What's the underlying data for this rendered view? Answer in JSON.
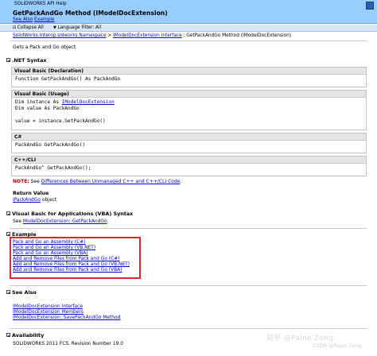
{
  "header": {
    "product": "SOLIDWORKS API Help",
    "title": "GetPackAndGo Method (IModelDocExtension)",
    "see_also": "See Also",
    "example": "Example"
  },
  "filterbar": {
    "collapse_all": "Collapse All",
    "language_filter": "Language Filter: All"
  },
  "breadcrumb": {
    "namespace": "SolidWorks.Interop.sldworks Namespace",
    "sep1": " > ",
    "interface": "IModelDocExtension Interface",
    "sep2": " : ",
    "current": "GetPackAndGo Method (IModelDocExtension)"
  },
  "summary": "Gets a Pack and Go object.",
  "syntax": {
    "heading": ".NET Syntax",
    "vb_decl_header": "Visual Basic (Declaration)",
    "vb_decl_code": "Function GetPackAndGo() As PackAndGo",
    "vb_usage_header": "Visual Basic (Usage)",
    "vb_usage_line1_prefix": "Dim instance As ",
    "vb_usage_line1_link": "IModelDocExtension",
    "vb_usage_line2": "Dim value As PackAndGo",
    "vb_usage_line3": "value = instance.GetPackAndGo()",
    "cs_header": "C#",
    "cs_code": "PackAndGo GetPackAndGo()",
    "cpp_header": "C++/CLI",
    "cpp_code": "PackAndGo^ GetPackAndGo();"
  },
  "note": {
    "label": "NOTE:",
    "text": " See ",
    "link": "Differences Between Unmanaged C++ and C++/CLI Code",
    "end": "."
  },
  "return_value": {
    "heading": "Return Value",
    "link": "IPackAndGo",
    "suffix": " object"
  },
  "vba": {
    "heading": "Visual Basic for Applications (VBA) Syntax",
    "see": "See ",
    "link": "ModelDocExtension::GetPackAndGo",
    "end": "."
  },
  "example": {
    "heading": "Example",
    "links": [
      "Pack and Go an Assembly (C#)",
      "Pack and Go an Assembly (VB.NET)",
      "Pack and Go an Assembly (VBA)",
      "Add and Remove Files from Pack and Go (C#)",
      "Add and Remove Files from Pack and Go (VB.NET)",
      "Add and Remove Files from Pack and Go (VBA)"
    ]
  },
  "see_also": {
    "heading": "See Also",
    "links": [
      "IModelDocExtension Interface",
      "IModelDocExtension Members",
      "IModelDocExtension::SavePackAndGo Method"
    ]
  },
  "availability": {
    "heading": "Availability",
    "text": "SOLIDWORKS 2011 FCS, Revision Number 19.0"
  },
  "watermark": {
    "main": "知乎 @Paine Zeng",
    "sub": "CSDN @Paine Zeng"
  },
  "colors": {
    "banner": "#99ccff",
    "link": "#0000cc",
    "highlight_box": "#d9262f"
  }
}
